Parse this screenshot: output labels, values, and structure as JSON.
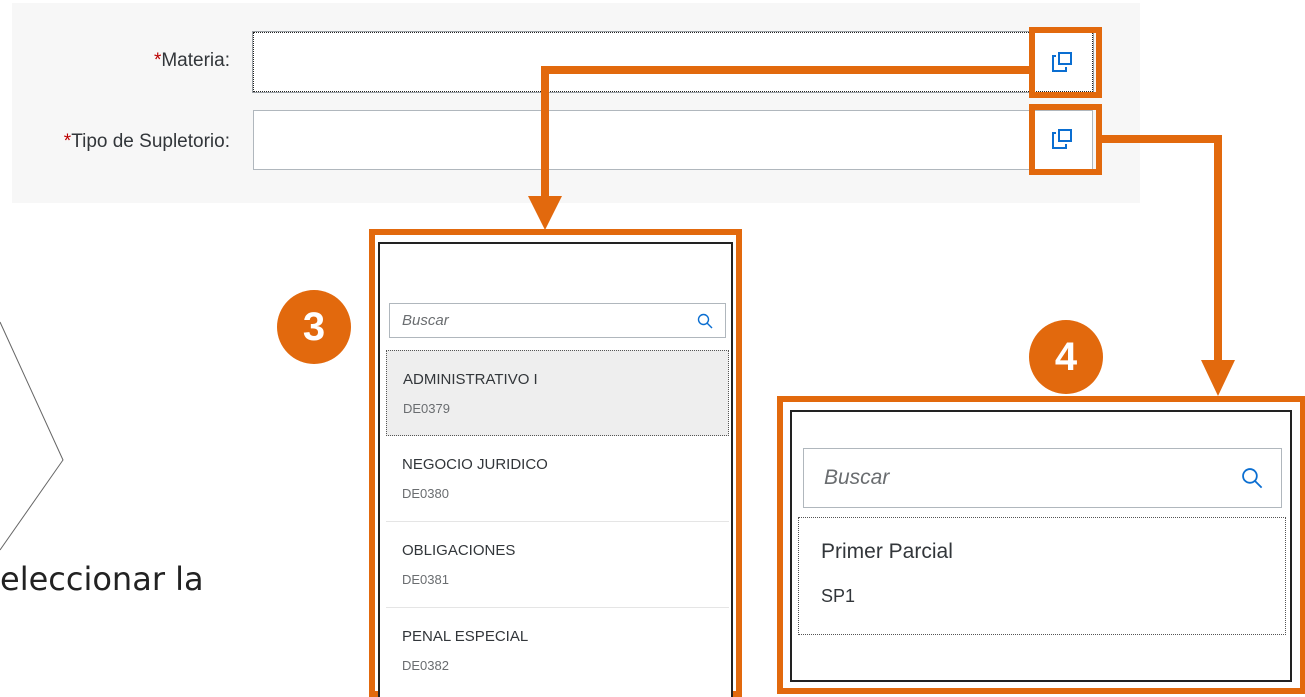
{
  "form": {
    "materia_label": "Materia:",
    "tipo_label": "Tipo de Supletorio:",
    "required_mark": "*",
    "materia_value": "",
    "tipo_value": ""
  },
  "popover_materia": {
    "badge": "3",
    "search_placeholder": "Buscar",
    "items": [
      {
        "title": "ADMINISTRATIVO I",
        "code": "DE0379"
      },
      {
        "title": "NEGOCIO JURIDICO",
        "code": "DE0380"
      },
      {
        "title": "OBLIGACIONES",
        "code": "DE0381"
      },
      {
        "title": "PENAL ESPECIAL",
        "code": "DE0382"
      }
    ]
  },
  "popover_tipo": {
    "badge": "4",
    "search_placeholder": "Buscar",
    "items": [
      {
        "title": "Primer Parcial",
        "code": "SP1"
      }
    ]
  },
  "background_text": "eleccionar la",
  "colors": {
    "accent": "#e2690d",
    "required": "#bb0000"
  },
  "icons": [
    "value-help-icon",
    "search-icon"
  ]
}
